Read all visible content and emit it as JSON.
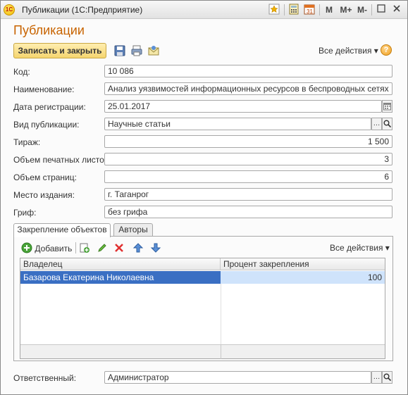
{
  "window": {
    "title": "Публикации  (1С:Предприятие)",
    "logo_text": "1С",
    "toolbar": {
      "m": "M",
      "m_plus": "M+",
      "m_minus": "M-"
    }
  },
  "header": {
    "title": "Публикации",
    "save_close_label": "Записать и закрыть",
    "all_actions": "Все действия ▾",
    "help": "?"
  },
  "fields": {
    "code": {
      "label": "Код:",
      "value": "10 086"
    },
    "name": {
      "label": "Наименование:",
      "value": "Анализ уязвимостей информационных ресурсов в беспроводных сетях"
    },
    "reg_date": {
      "label": "Дата регистрации:",
      "value": "25.01.2017"
    },
    "pub_type": {
      "label": "Вид публикации:",
      "value": "Научные статьи"
    },
    "circulation": {
      "label": "Тираж:",
      "value": "1 500"
    },
    "print_sheets": {
      "label": "Объем печатных листов:",
      "value": "3"
    },
    "pages": {
      "label": "Объем страниц:",
      "value": "6"
    },
    "place": {
      "label": "Место издания:",
      "value": "г. Таганрог"
    },
    "stamp": {
      "label": "Гриф:",
      "value": "без грифа"
    },
    "responsible": {
      "label": "Ответственный:",
      "value": "Администратор"
    }
  },
  "tabs": [
    {
      "label": "Закрепление объектов",
      "active": true
    },
    {
      "label": "Авторы",
      "active": false
    }
  ],
  "table": {
    "add_label": "Добавить",
    "all_actions": "Все действия ▾",
    "columns": [
      "Владелец",
      "Процент закрепления"
    ],
    "rows": [
      {
        "owner": "Базарова Екатерина Николаевна",
        "percent": "100"
      }
    ]
  },
  "colors": {
    "title": "#c86400",
    "selected_row": "#3a6fc3",
    "selected_cell": "#cfe3fb",
    "primary_button": "#f5d56f"
  }
}
